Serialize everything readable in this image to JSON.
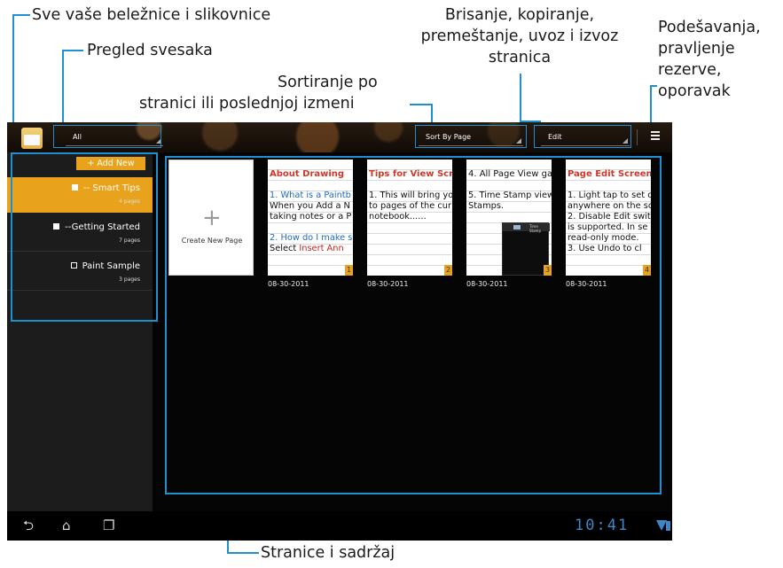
{
  "annotations": {
    "all_notebooks": "Sve vaše beležnice i slikovnice",
    "notebook_overview": "Pregled svesaka",
    "sort_1": "Sortiranje po",
    "sort_2": "stranici ili poslednjoj izmeni",
    "edit_1": "Brisanje, kopiranje,",
    "edit_2": "premeštanje, uvoz i izvoz",
    "edit_3": "stranica",
    "settings_1": "Podešavanja,",
    "settings_2": "pravljenje",
    "settings_3": "rezerve,",
    "settings_4": "oporavak",
    "pages_content": "Stranice i sadržaj"
  },
  "actionbar": {
    "filter_value": "All",
    "sort_value": "Sort By Page",
    "edit_value": "Edit"
  },
  "sidebar": {
    "add_new_label": "+ Add New",
    "notebooks": [
      {
        "title": "-- Smart Tips",
        "pages": "4 pages",
        "selected": true
      },
      {
        "title": "--Getting Started",
        "pages": "7 pages",
        "selected": false
      },
      {
        "title": "Paint Sample",
        "pages": "3 pages",
        "selected": false
      }
    ]
  },
  "pages": {
    "create_label": "Create New Page",
    "thumbnails": [
      {
        "title": "About Drawing",
        "lines": [
          "1. What is a Paintb",
          "When you Add a N",
          "taking notes or a P",
          "",
          "2. How do I make s",
          "Select Insert Ann"
        ],
        "number": "1",
        "date": "08-30-2011"
      },
      {
        "title": "Tips for View Scre",
        "lines": [
          "1. This will bring yo",
          "to pages of the cur",
          "notebook......"
        ],
        "number": "2",
        "date": "08-30-2011"
      },
      {
        "title": "4. All Page View ga",
        "lines": [
          "5. Time Stamp view",
          "Stamps."
        ],
        "number": "3",
        "date": "08-30-2011",
        "inset_label": "Time Stamp"
      },
      {
        "title": "Page Edit Screen",
        "lines": [
          "1. Light tap to set o",
          "anywhere on the sc",
          "2. Disable Edit swit",
          "is supported. In se",
          "read-only mode.",
          "3. Use Undo to cl"
        ],
        "number": "4",
        "date": "08-30-2011"
      }
    ]
  },
  "statusbar": {
    "clock": "10:41"
  },
  "colors": {
    "accent_orange": "#e9a21b",
    "highlight_blue": "#1f8fd0",
    "clock_blue": "#3f86c8"
  },
  "icons": [
    "app-notebook-icon",
    "overflow-menu-icon",
    "back-icon",
    "home-icon",
    "recent-apps-icon",
    "signal-icon",
    "battery-icon",
    "plus-icon",
    "notebook-icon",
    "paint-icon"
  ]
}
